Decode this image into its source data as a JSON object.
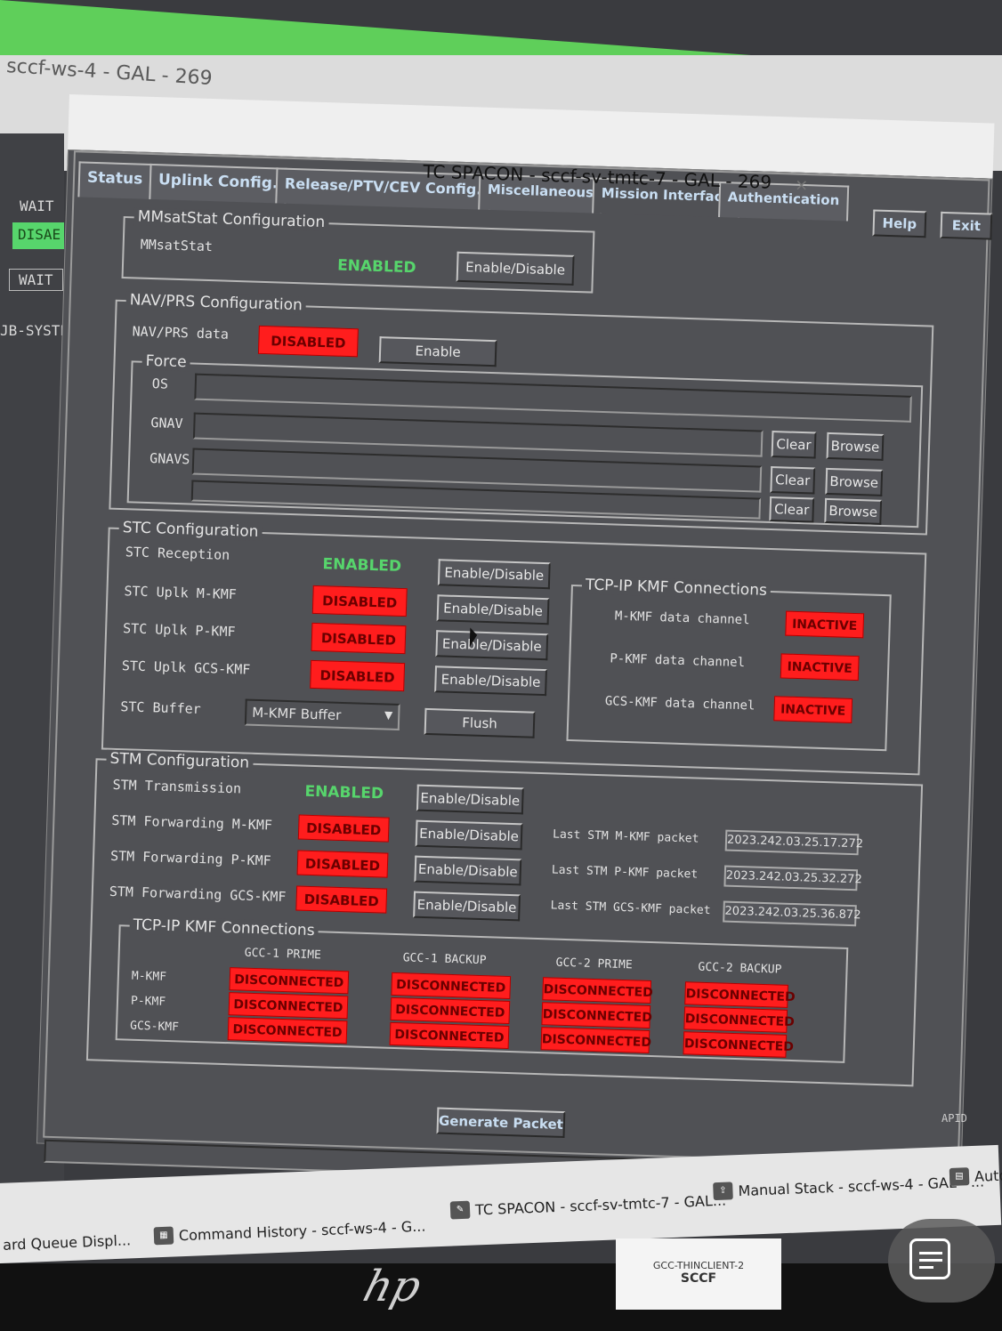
{
  "background": {
    "window_title": "sccf-ws-4 - GAL - 269",
    "left_panel": {
      "wait1": "WAIT",
      "disabled": "DISAE",
      "wait2": "WAIT",
      "subsystem": "JB-SYSTE"
    }
  },
  "dialog": {
    "title": "TC SPACON - sccf-sv-tmtc-7 - GAL - 269",
    "min_glyph": "–",
    "close_glyph": "×",
    "tabs": [
      "Status",
      "Uplink Config.",
      "Release/PTV/CEV Config.",
      "Miscellaneous",
      "Mission Interface",
      "Authentication"
    ],
    "help_label": "Help",
    "exit_label": "Exit",
    "exit_glyph": "–",
    "close2_glyph": "×"
  },
  "mmsat": {
    "legend": "MMsatStat Configuration",
    "label": "MMsatStat",
    "status": "ENABLED",
    "button": "Enable/Disable"
  },
  "navprs": {
    "legend": "NAV/PRS Configuration",
    "label": "NAV/PRS data",
    "status": "DISABLED",
    "button": "Enable",
    "force_legend": "Force",
    "rows": [
      {
        "label": "OS",
        "value": ""
      },
      {
        "label": "GNAV",
        "value": "",
        "clear": "Clear",
        "browse": "Browse"
      },
      {
        "label": "GNAVS",
        "value": "",
        "clear": "Clear",
        "browse": "Browse"
      },
      {
        "label": "",
        "value": "",
        "clear": "Clear",
        "browse": "Browse"
      }
    ]
  },
  "stc": {
    "legend": "STC Configuration",
    "rows": [
      {
        "label": "STC Reception",
        "status": "ENABLED",
        "button": "Enable/Disable"
      },
      {
        "label": "STC Uplk M-KMF",
        "status": "DISABLED",
        "button": "Enable/Disable"
      },
      {
        "label": "STC Uplk P-KMF",
        "status": "DISABLED",
        "button": "Enable/Disable"
      },
      {
        "label": "STC Uplk GCS-KMF",
        "status": "DISABLED",
        "button": "Enable/Disable"
      }
    ],
    "buffer_label": "STC Buffer",
    "buffer_value": "M-KMF Buffer",
    "flush": "Flush",
    "tcp": {
      "legend": "TCP-IP KMF Connections",
      "rows": [
        {
          "label": "M-KMF data channel",
          "status": "INACTIVE"
        },
        {
          "label": "P-KMF data channel",
          "status": "INACTIVE"
        },
        {
          "label": "GCS-KMF data channel",
          "status": "INACTIVE"
        }
      ]
    }
  },
  "stm": {
    "legend": "STM Configuration",
    "rows": [
      {
        "label": "STM Transmission",
        "status": "ENABLED",
        "button": "Enable/Disable",
        "last_label": "",
        "last_value": ""
      },
      {
        "label": "STM Forwarding M-KMF",
        "status": "DISABLED",
        "button": "Enable/Disable",
        "last_label": "Last STM M-KMF packet",
        "last_value": "2023.242.03.25.17.272"
      },
      {
        "label": "STM Forwarding P-KMF",
        "status": "DISABLED",
        "button": "Enable/Disable",
        "last_label": "Last STM P-KMF packet",
        "last_value": "2023.242.03.25.32.272"
      },
      {
        "label": "STM Forwarding GCS-KMF",
        "status": "DISABLED",
        "button": "Enable/Disable",
        "last_label": "Last STM GCS-KMF packet",
        "last_value": "2023.242.03.25.36.872"
      }
    ],
    "tcp": {
      "legend": "TCP-IP KMF Connections",
      "columns": [
        "GCC-1 PRIME",
        "GCC-1 BACKUP",
        "GCC-2 PRIME",
        "GCC-2 BACKUP"
      ],
      "rows": [
        "M-KMF",
        "P-KMF",
        "GCS-KMF"
      ],
      "cell": "DISCONNECTED"
    }
  },
  "footer": {
    "generate": "Generate Packet",
    "apid": "APID"
  },
  "taskbar": {
    "items": [
      {
        "label": "ard Queue Displ..."
      },
      {
        "label": "Command History  - sccf-ws-4 - G..."
      },
      {
        "label": "TC SPACON - sccf-sv-tmtc-7 - GAL..."
      },
      {
        "label": "Manual Stack  - sccf-ws-4 - GAL - ..."
      },
      {
        "label": "Autom"
      }
    ]
  },
  "hardware": {
    "brand": "hp",
    "sticker_line1": "GCC-THINCLIENT-2",
    "sticker_line2": "SCCF"
  },
  "colors": {
    "enabled": "#57d56c",
    "disabled": "#ff1d1d",
    "panel": "#505155",
    "tab_text": "#c9def2"
  }
}
